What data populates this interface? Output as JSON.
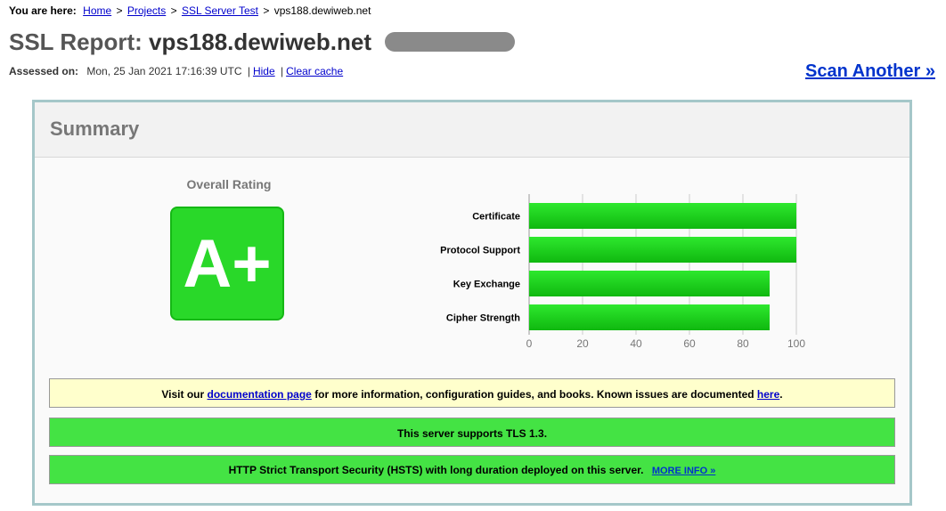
{
  "breadcrumb": {
    "prefix": "You are here:",
    "home": "Home",
    "projects": "Projects",
    "ssl_test": "SSL Server Test",
    "current": "vps188.dewiweb.net",
    "separator": ">"
  },
  "header": {
    "title_prefix": "SSL Report:",
    "host": "vps188.dewiweb.net",
    "assessed_label": "Assessed on:",
    "assessed_value": "Mon, 25 Jan 2021 17:16:39 UTC",
    "hide_link": "Hide",
    "clear_cache_link": "Clear cache",
    "scan_another": "Scan Another »"
  },
  "summary": {
    "title": "Summary",
    "overall_rating_label": "Overall Rating",
    "grade": "A+"
  },
  "chart_data": {
    "type": "bar",
    "orientation": "horizontal",
    "categories": [
      "Certificate",
      "Protocol Support",
      "Key Exchange",
      "Cipher Strength"
    ],
    "values": [
      100,
      100,
      90,
      90
    ],
    "xlim": [
      0,
      100
    ],
    "ticks": [
      0,
      20,
      40,
      60,
      80,
      100
    ],
    "grid": true,
    "bar_color": "#1ec71e"
  },
  "messages": {
    "info_prefix": "Visit our",
    "info_link": "documentation page",
    "info_middle": "for more information, configuration guides, and books. Known issues are documented",
    "info_here": "here",
    "info_suffix": ".",
    "tls": "This server supports TLS 1.3.",
    "hsts": "HTTP Strict Transport Security (HSTS) with long duration deployed on this server.",
    "more_info": "MORE INFO »"
  },
  "colors": {
    "grade_bg": "#29d829",
    "warning_bg": "#ffffcc",
    "success_bg": "#44e344",
    "border": "#a5c7c9",
    "link": "#0000cc"
  }
}
